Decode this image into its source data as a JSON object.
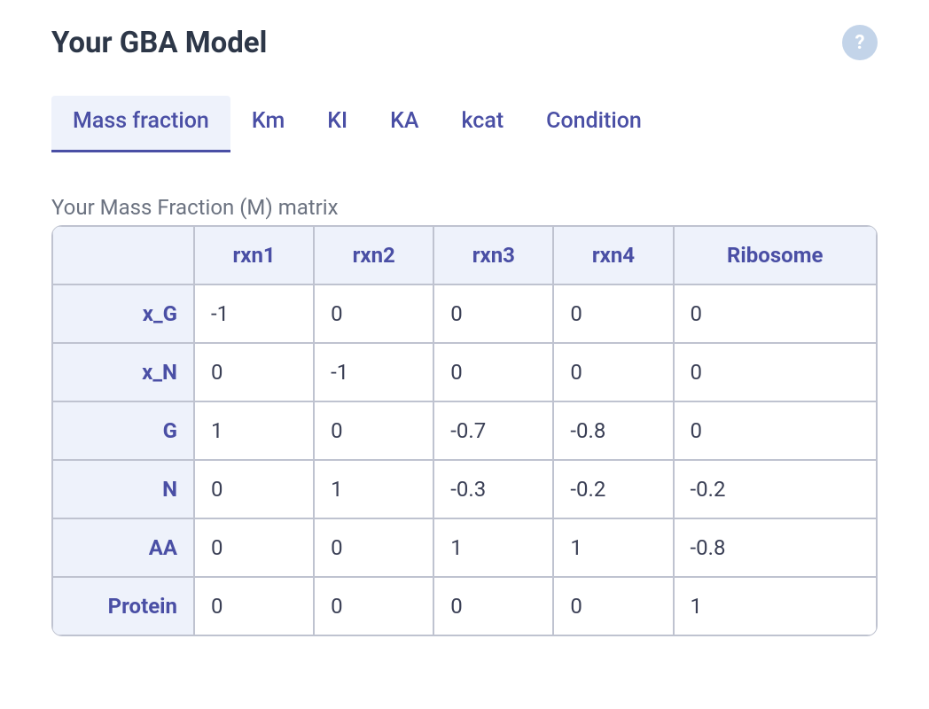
{
  "header": {
    "title": "Your GBA Model",
    "help_label": "?"
  },
  "tabs": [
    {
      "label": "Mass fraction",
      "active": true
    },
    {
      "label": "Km",
      "active": false
    },
    {
      "label": "KI",
      "active": false
    },
    {
      "label": "KA",
      "active": false
    },
    {
      "label": "kcat",
      "active": false
    },
    {
      "label": "Condition",
      "active": false
    }
  ],
  "section": {
    "label": "Your Mass Fraction (M) matrix"
  },
  "matrix": {
    "columns": [
      "rxn1",
      "rxn2",
      "rxn3",
      "rxn4",
      "Ribosome"
    ],
    "rows": [
      {
        "name": "x_G",
        "values": [
          "-1",
          "0",
          "0",
          "0",
          "0"
        ]
      },
      {
        "name": "x_N",
        "values": [
          "0",
          "-1",
          "0",
          "0",
          "0"
        ]
      },
      {
        "name": "G",
        "values": [
          "1",
          "0",
          "-0.7",
          "-0.8",
          "0"
        ]
      },
      {
        "name": "N",
        "values": [
          "0",
          "1",
          "-0.3",
          "-0.2",
          "-0.2"
        ]
      },
      {
        "name": "AA",
        "values": [
          "0",
          "0",
          "1",
          "1",
          "-0.8"
        ]
      },
      {
        "name": "Protein",
        "values": [
          "0",
          "0",
          "0",
          "0",
          "1"
        ]
      }
    ]
  }
}
